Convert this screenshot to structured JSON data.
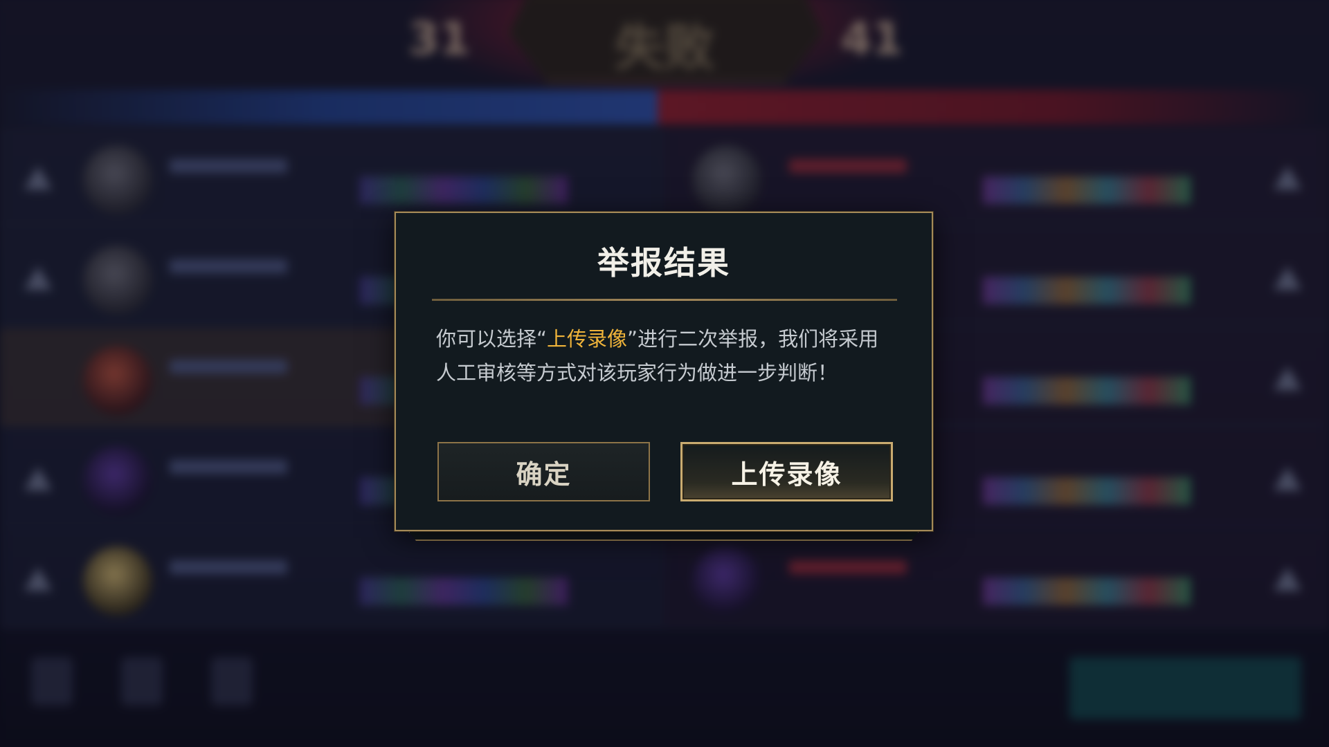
{
  "dialog": {
    "title": "举报结果",
    "message_part1": "你可以选择“",
    "message_highlight": "上传录像",
    "message_part2": "”进行二次举报，我们将采用人工审核等方式对该玩家行为做进一步判断！",
    "confirm_label": "确定",
    "upload_label": "上传录像"
  },
  "background": {
    "result_text": "失败",
    "score_left": "31",
    "score_right": "41"
  },
  "colors": {
    "highlight": "#f0b43a",
    "dialog_border": "#a58a58",
    "dialog_bg": "#121a1f"
  }
}
